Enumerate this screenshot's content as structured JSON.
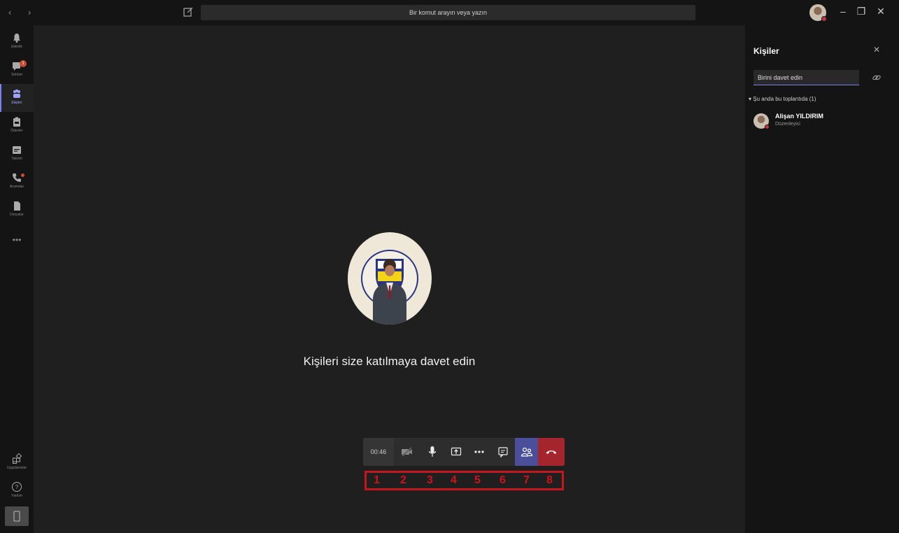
{
  "titlebar": {
    "search_text": "Bir komut arayın veya yazın",
    "window_controls": {
      "minimize": "–",
      "restore": "❐",
      "close": "✕"
    }
  },
  "rail": {
    "items": [
      {
        "label": "Etkinlik",
        "icon": "bell-icon"
      },
      {
        "label": "Sohbet",
        "icon": "chat-icon",
        "badge": "1"
      },
      {
        "label": "Ekipler",
        "icon": "teams-icon",
        "active": true
      },
      {
        "label": "Ödevler",
        "icon": "assignments-icon"
      },
      {
        "label": "Takvim",
        "icon": "calendar-icon"
      },
      {
        "label": "Aramalar",
        "icon": "phone-icon"
      },
      {
        "label": "Dosyalar",
        "icon": "files-icon"
      }
    ],
    "more": "•••",
    "bottom": [
      {
        "label": "Uygulamalar",
        "icon": "apps-icon"
      },
      {
        "label": "Yardım",
        "icon": "help-icon"
      }
    ]
  },
  "stage": {
    "invite_text": "Kişileri size katılmaya davet edin"
  },
  "callbar": {
    "timer": "00:46",
    "numbers": [
      "1",
      "2",
      "3",
      "4",
      "5",
      "6",
      "7",
      "8"
    ]
  },
  "panel": {
    "title": "Kişiler",
    "invite_placeholder": "Birini davet edin",
    "section_label": "Şu anda bu toplantıda (1)",
    "participant": {
      "name": "Alişan YILDIRIM",
      "role": "Düzenleyici"
    }
  },
  "colors": {
    "accent": "#7b83eb",
    "people_button": "#4b4e9a",
    "hangup": "#a4262c",
    "annotation": "#c4161c"
  }
}
